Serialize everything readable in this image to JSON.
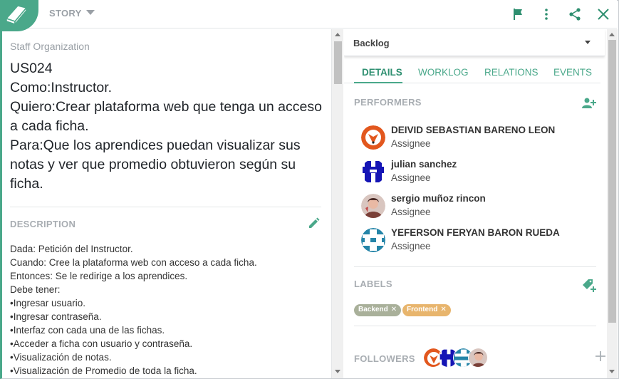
{
  "header": {
    "type_label": "STORY",
    "colors": {
      "accent": "#4aa88a"
    },
    "icons": [
      "book-icon",
      "flag-icon",
      "more-vert-icon",
      "share-icon",
      "close-icon"
    ]
  },
  "story": {
    "project": "Staff Organization",
    "lines": [
      "US024",
      "Como:Instructor.",
      "Quiero:Crear plataforma web que tenga un acceso a cada ficha.",
      "Para:Que los aprendices puedan visualizar sus notas y ver que promedio obtuvieron según su ficha."
    ]
  },
  "description": {
    "title": "DESCRIPTION",
    "lines": [
      "Dada: Petición del Instructor.",
      "Cuando: Cree la plataforma web con acceso a cada ficha.",
      "Entonces: Se le redirige a los aprendices.",
      "Debe tener:",
      "•Ingresar  usuario.",
      "•Ingresar contraseña.",
      "•Interfaz con cada una de las fichas.",
      "•Acceder a ficha con usuario y contraseña.",
      "•Visualización de notas.",
      "•Visualización de Promedio de toda la ficha."
    ]
  },
  "status": {
    "selected": "Backlog"
  },
  "tabs": [
    {
      "label": "DETAILS",
      "active": true
    },
    {
      "label": "WORKLOG",
      "active": false
    },
    {
      "label": "RELATIONS",
      "active": false
    },
    {
      "label": "EVENTS",
      "active": false
    }
  ],
  "performers": {
    "title": "PERFORMERS",
    "items": [
      {
        "name": "DEIVID SEBASTIAN BARENO LEON",
        "role": "Assignee",
        "avatar": "fox-avatar"
      },
      {
        "name": "julian sanchez",
        "role": "Assignee",
        "avatar": "blue-identicon-avatar"
      },
      {
        "name": "sergio muñoz rincon",
        "role": "Assignee",
        "avatar": "photo-avatar"
      },
      {
        "name": "YEFERSON FERYAN BARON RUEDA",
        "role": "Assignee",
        "avatar": "teal-identicon-avatar"
      }
    ]
  },
  "labels": {
    "title": "LABELS",
    "items": [
      {
        "text": "Backend",
        "color": "#a9b09a"
      },
      {
        "text": "Frontend",
        "color": "#e8b56d"
      }
    ]
  },
  "followers": {
    "title": "FOLLOWERS"
  }
}
